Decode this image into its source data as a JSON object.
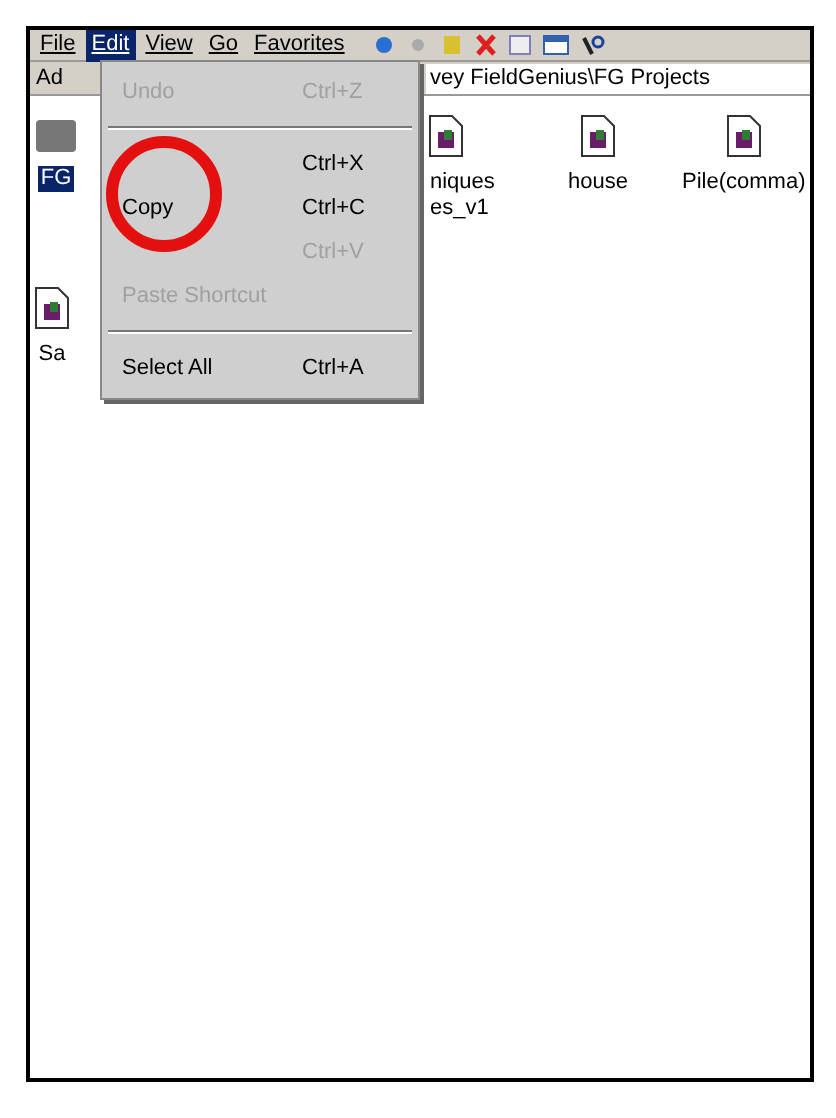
{
  "menu_bar": [
    {
      "label": "File",
      "selected": false
    },
    {
      "label": "Edit",
      "selected": true
    },
    {
      "label": "View",
      "selected": false
    },
    {
      "label": "Go",
      "selected": false
    },
    {
      "label": "Favorites",
      "selected": false
    }
  ],
  "address_bar": {
    "label": "Ad",
    "path": "vey FieldGenius\\FG Projects"
  },
  "files": [
    {
      "label": "FG",
      "selected": true,
      "kind": "folder"
    },
    {
      "label": "niques\nes_v1",
      "selected": false,
      "kind": "document"
    },
    {
      "label": "house",
      "selected": false,
      "kind": "document"
    },
    {
      "label": "Pile(comma)",
      "selected": false,
      "kind": "document"
    },
    {
      "label": "Sa",
      "selected": false,
      "kind": "document"
    }
  ],
  "edit_menu": [
    {
      "kind": "item",
      "label": "Undo",
      "shortcut": "Ctrl+Z",
      "disabled": true
    },
    {
      "kind": "separator"
    },
    {
      "kind": "item",
      "shortcut": "Ctrl+X",
      "disabled": false
    },
    {
      "kind": "item",
      "label": "Copy",
      "shortcut": "Ctrl+C",
      "disabled": false
    },
    {
      "kind": "item",
      "shortcut": "Ctrl+V",
      "disabled": true
    },
    {
      "kind": "item",
      "label": "Paste Shortcut",
      "disabled": true
    },
    {
      "kind": "separator"
    },
    {
      "kind": "item",
      "label": "Select All",
      "shortcut": "Ctrl+A",
      "disabled": false
    }
  ]
}
